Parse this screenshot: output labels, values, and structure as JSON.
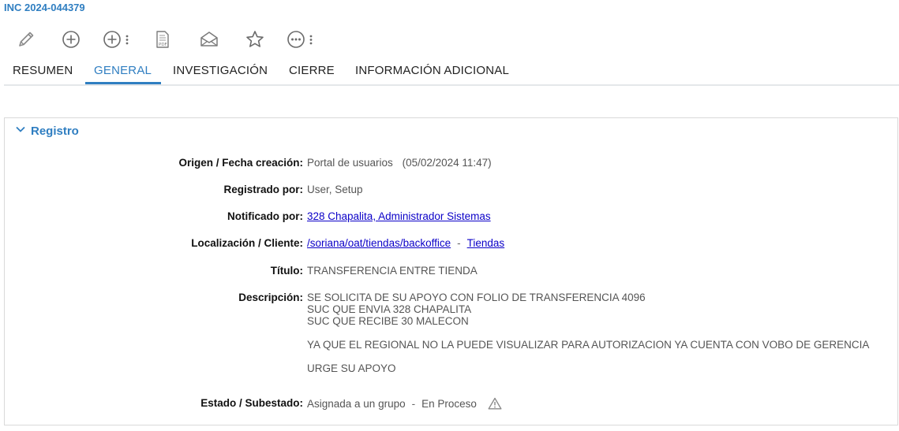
{
  "ticket": {
    "id": "INC 2024-044379"
  },
  "toolbar": {
    "buttons": [
      {
        "icon": "pencil-icon"
      },
      {
        "icon": "add-circle-icon"
      },
      {
        "icon": "add-circle-more-icon"
      },
      {
        "icon": "pdf-icon"
      },
      {
        "icon": "envelope-icon"
      },
      {
        "icon": "star-icon"
      },
      {
        "icon": "more-circle-icon"
      }
    ]
  },
  "tabs": [
    {
      "label": "RESUMEN",
      "active": false
    },
    {
      "label": "GENERAL",
      "active": true
    },
    {
      "label": "INVESTIGACIÓN",
      "active": false
    },
    {
      "label": "CIERRE",
      "active": false
    },
    {
      "label": "INFORMACIÓN ADICIONAL",
      "active": false
    }
  ],
  "section": {
    "title": "Registro",
    "expanded": true
  },
  "fields": {
    "origen": {
      "label": "Origen / Fecha creación:",
      "value": "Portal de usuarios",
      "date": "(05/02/2024 11:47)"
    },
    "registrado": {
      "label": "Registrado por:",
      "value": "User, Setup"
    },
    "notificado": {
      "label": "Notificado por:",
      "link": "328 Chapalita, Administrador Sistemas"
    },
    "localizacion": {
      "label": "Localización / Cliente:",
      "link1": "/soriana/oat/tiendas/backoffice",
      "sep": "-",
      "link2": "Tiendas"
    },
    "titulo": {
      "label": "Título:",
      "value": "TRANSFERENCIA ENTRE TIENDA"
    },
    "descripcion": {
      "label": "Descripción:",
      "lines": [
        "SE SOLICITA DE SU APOYO CON FOLIO DE TRANSFERENCIA 4096",
        "SUC  QUE ENVIA 328 CHAPALITA",
        "SUC QUE RECIBE 30 MALECON",
        "",
        "YA QUE EL REGIONAL NO LA PUEDE VISUALIZAR PARA AUTORIZACION YA CUENTA CON VOBO DE GERENCIA",
        "URGE SU APOYO"
      ]
    },
    "estado": {
      "label": "Estado / Subestado:",
      "value": "Asignada a un grupo",
      "sep": "-",
      "subvalue": "En Proceso"
    }
  },
  "colors": {
    "accent": "#2f7ec1",
    "link": "#0b00c8",
    "icon": "#6b6b6b"
  }
}
